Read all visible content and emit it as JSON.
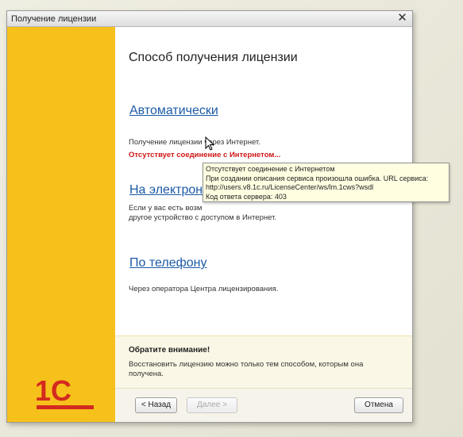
{
  "window": {
    "title": "Получение лицензии",
    "close_glyph": "✕"
  },
  "heading": "Способ получения лицензии",
  "options": {
    "auto": {
      "label": "Автоматически",
      "description": "Получение лицензии через Интернет.",
      "error": "Отсутствует соединение с Интернетом..."
    },
    "electronic": {
      "label": "На электронный",
      "description_line1": "Если у вас есть возм",
      "description_line2": "другое устройство с доступом в Интернет."
    },
    "phone": {
      "label": "По телефону",
      "description": "Через оператора Центра лицензирования."
    }
  },
  "notice": {
    "title": "Обратите внимание!",
    "text": "Восстановить лицензию можно только тем способом, которым она получена."
  },
  "buttons": {
    "back": "< Назад",
    "next": "Далее >",
    "cancel": "Отмена"
  },
  "tooltip": {
    "line1": "Отсутствует соединение с Интернетом",
    "line2": "При создании описания сервиса произошла ошибка. URL сервиса:",
    "line3": "http://users.v8.1c.ru/LicenseCenter/ws/lm.1cws?wsdl",
    "line4": "Код ответа сервера: 403"
  },
  "logo": {
    "text": "1С",
    "color": "#d32a1f"
  },
  "colors": {
    "sidebar": "#f6c11b",
    "link": "#1c5aa5",
    "error": "#d01616",
    "tooltip_bg": "#fffee1"
  }
}
